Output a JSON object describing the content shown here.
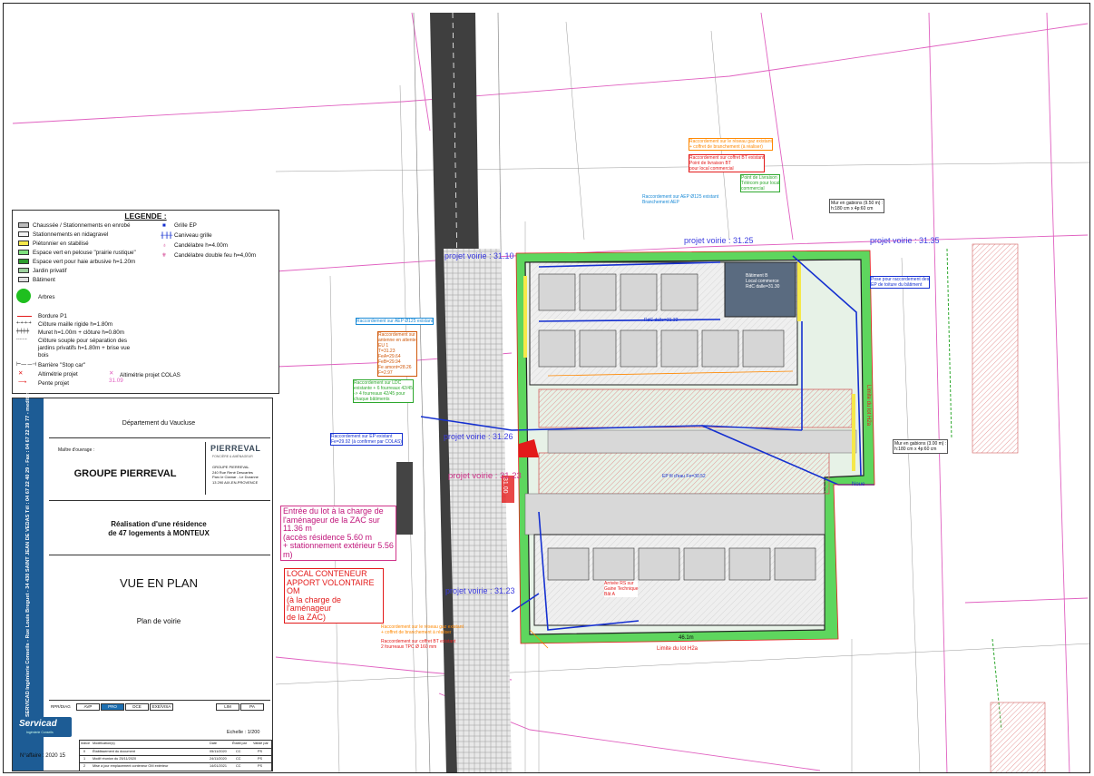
{
  "legend": {
    "title": "LEGENDE :",
    "left_items": [
      "Chaussée / Stationnements en enrobé",
      "Stationnements en nidagravel",
      "Piétonnier en stabilisé",
      "Espace vert en pelouse \"prairie rustique\"",
      "Espace vert pour haie arbusive h=1.20m",
      "Jardin privatif",
      "Bâtiment"
    ],
    "right_items": [
      "Grille EP",
      "Caniveau grille",
      "Candélabre h=4.00m",
      "Candélabre double feu h=4,00m"
    ],
    "arbres": "Arbres",
    "line_items": [
      "Bordure P1",
      "Clôture maille rigide h=1.80m",
      "Muret h=1.00m + clôture h=0.80m",
      "Clôture souple pour séparation des",
      "jardins privatifs h=1.80m + brise vue",
      "bois",
      "Barrière \"Stop car\"",
      "Altimétrie projet",
      "Pente projet"
    ],
    "alti_colas": "Altimétrie projet COLAS",
    "alti_val": "31.09"
  },
  "cartouche": {
    "band_text": "SERVICAD Ingénierie Conseils - Rue Louis Breguet - 34 430 SAINT JEAN DE VEDAS   Tél : 04 67 22 40 29 - Fax : 04 67 22 39 77 - mediterranee@servicad.fr",
    "departement": "Département du Vaucluse",
    "maitre_label": "Maître d'ouvrage :",
    "client": "GROUPE PIERREVAL",
    "logo": "PIERREVAL",
    "logo_sub": "FONCIÈRE & AMÉNAGEUR",
    "address": [
      "GROUPE PIERREVAL",
      "240 Rue René Descartes",
      "Parc le Clamar - Le Duranne",
      "13 290 AIX-EN-PROVENCE"
    ],
    "project_line1": "Réalisation d'une résidence",
    "project_line2": "de 47 logements à MONTEUX",
    "view_title": "VUE EN PLAN",
    "view_sub": "Plan de voirie",
    "phase_label": "RPR/DIAG",
    "phases": [
      "AVP",
      "PRO",
      "DCE",
      "EXE/VISA",
      "LIM",
      "PA"
    ],
    "active_phase": "PRO",
    "echelle": "Echelle : 1/200",
    "affaire": "N°affaire : 2020 15",
    "brand": "Servicad",
    "brand_sub": "Ingénierie Conseils",
    "table_headers": [
      "Indice",
      "Modification(s)",
      "Date",
      "Établi par",
      "Validé par"
    ],
    "table_rows": [
      [
        "0",
        "Établissement du document",
        "05/11/2020",
        "CC",
        "PS"
      ],
      [
        "1",
        "Modif réunion du 25/11/2020",
        "24/11/2020",
        "CC",
        "PS"
      ],
      [
        "2",
        "Mise à jour emplacement conteneur OM extérieur",
        "14/01/2021",
        "CC",
        "PS"
      ]
    ]
  },
  "plan": {
    "projet_voirie": [
      "projet voirie : 31.10",
      "projet voirie : 31.25",
      "projet voirie : 31.35",
      "projet voirie : 31.26",
      "projet voirie : 31.23",
      "projet voirie : 31.23"
    ],
    "entree_lot": [
      "Entrée du lot à la charge de",
      "l'aménageur de la ZAC sur 11.36 m",
      "(accès résidence 5.60 m",
      "+ stationnement extérieur 5.56 m)"
    ],
    "local_conteneur": [
      "LOCAL CONTENEUR",
      "APPORT VOLONTAIRE OM",
      "(à la charge de l'aménageur",
      "de la ZAC)"
    ],
    "mur_gabions_1": [
      "Mur en gabions (9.50 m) :",
      "h:180 cm x 4p:60 cm"
    ],
    "mur_gabions_2": [
      "Mur en gabions (3.00 m) :",
      "h:180 cm x 4p:60 cm"
    ],
    "raccord_gaz": [
      "Raccordement sur le réseau gaz existant",
      "+ coffret de branchement (à réaliser)"
    ],
    "raccord_bt": [
      "Raccordement sur coffret BT existant",
      "Point de livraison BT",
      "pour local commercial"
    ],
    "point_livraison": [
      "Point de Livraison",
      "Télécom pour local",
      "commercial"
    ],
    "raccord_aep1": "Raccordement sur AEP Ø125 existant",
    "raccord_aep_bt": [
      "Raccordement sur AEP Ø125 existant",
      "Branchement AEP"
    ],
    "raccord_antenne": [
      "Raccordement sur",
      "antenne en attente",
      "EU 1",
      "T=31.23",
      "FeA=29.64",
      "FeB=29.94",
      "Fe amont=28.26",
      "F=2.97"
    ],
    "raccord_ldc": [
      "Raccordement sur LDC",
      "existante + 6 fourreaux 42/45",
      "-> 4 fourreaux 42/45 pour",
      "chaque bâtiments"
    ],
    "raccord_ep": [
      "Raccordement sur EP existant",
      "Fe=29.92 (à confirmer par COLAS)"
    ],
    "pose_ep": [
      "Pose pour raccordement des",
      "EP de toiture du bâtiment"
    ],
    "limite_est": "Limite du lot H2a",
    "limite_sud": "Limite du lot H2a",
    "batiment_b": [
      "Bâtiment B",
      "Local commerce",
      "RdC dalle=31.30"
    ],
    "alti_bat": "RdC dalle=31.32",
    "arrivee_rs": [
      "Arrivée RS sur",
      "Gaine Technique",
      "Bât A"
    ],
    "raccord_gaz2": [
      "Raccordement sur le réseau gaz existant",
      "+ coffret de branchement à réaliser"
    ],
    "raccord_bt2": [
      "Raccordement sur coffret BT existant",
      "2 fourreaux TPC Ø 160 mm"
    ],
    "dim_sud": "46.1m",
    "noue": "Noue",
    "ep_label": "EP fil d'eau Fe=30.52",
    "v_31": "31.00"
  }
}
